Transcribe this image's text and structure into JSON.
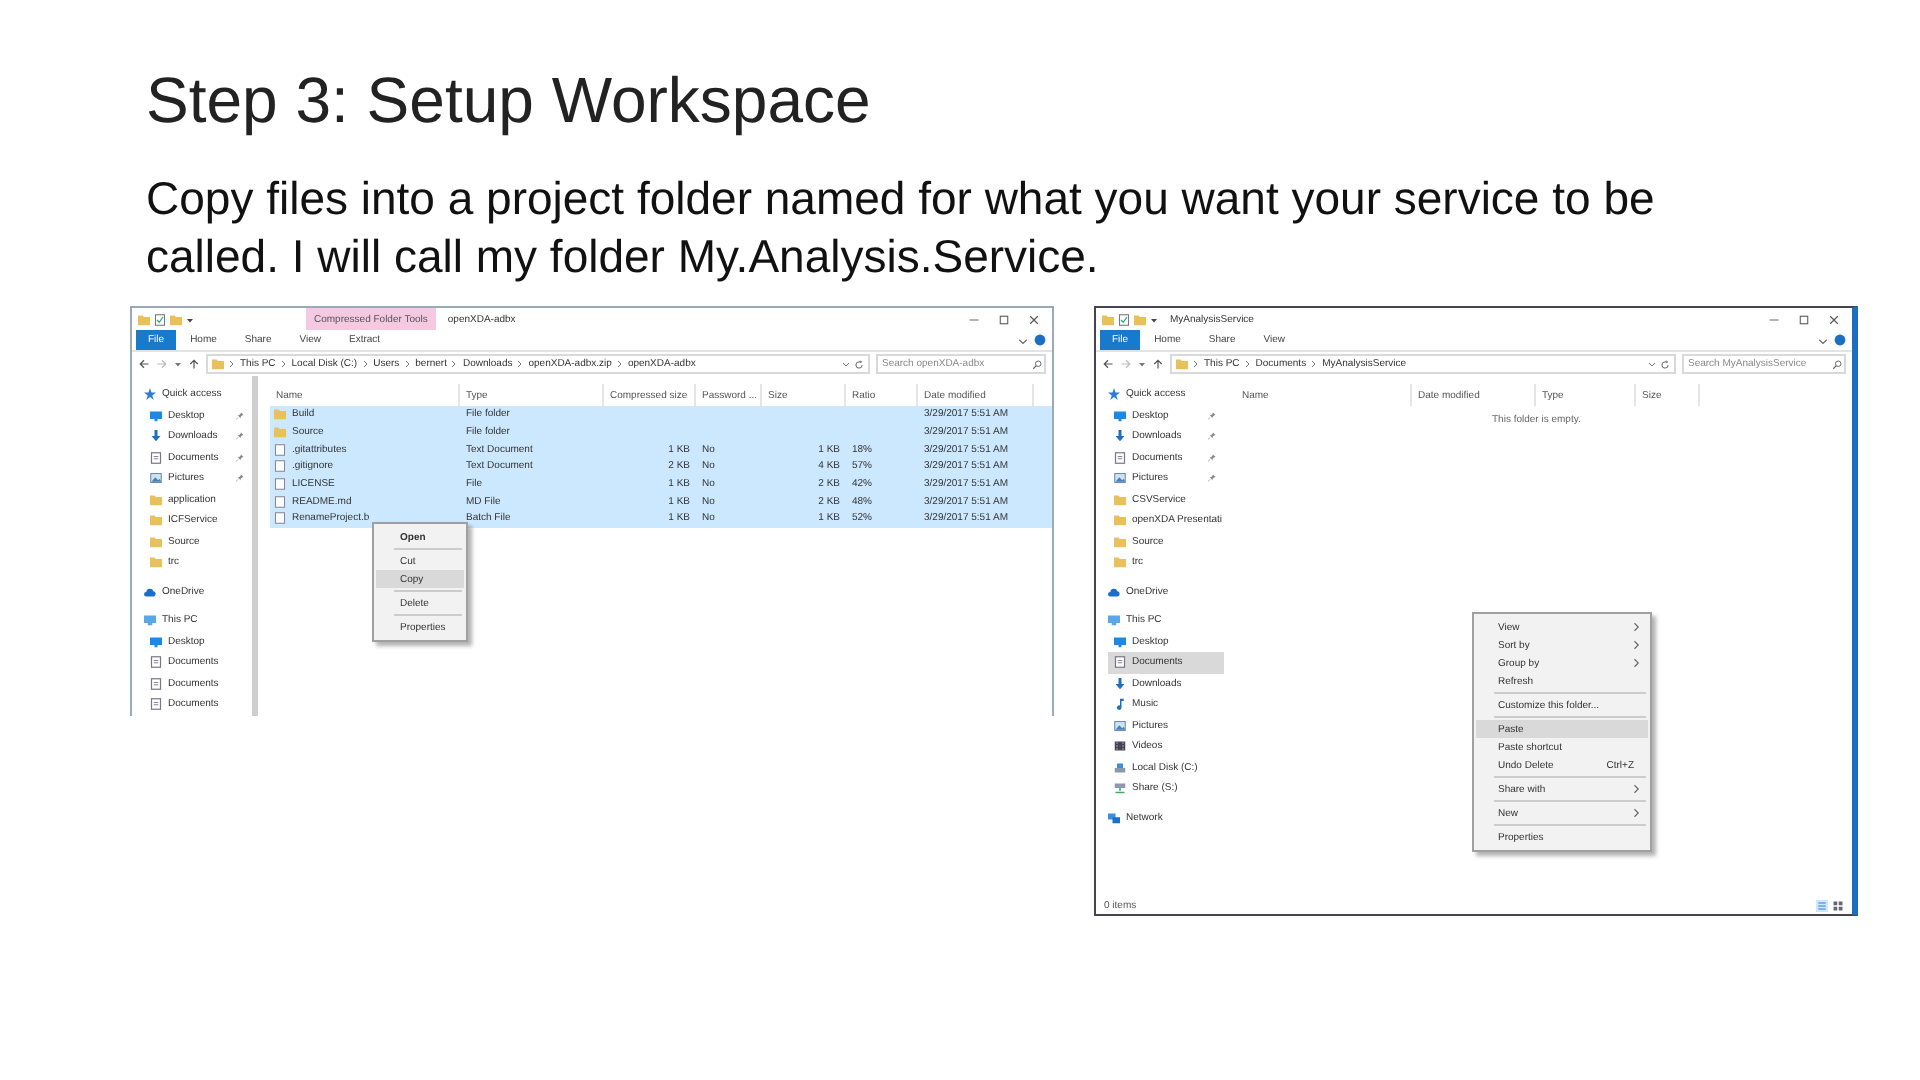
{
  "slide": {
    "title": "Step 3: Setup Workspace",
    "body": "Copy files into a project folder named for what you want your service to be called. I will call my folder My.Analysis.Service."
  },
  "left_window": {
    "contextual_tab": "Compressed Folder Tools",
    "title": "openXDA-adbx",
    "ribbon_tabs": [
      {
        "label": "File",
        "kind": "file"
      },
      {
        "label": "Home",
        "kind": "tab"
      },
      {
        "label": "Share",
        "kind": "tab"
      },
      {
        "label": "View",
        "kind": "tab"
      },
      {
        "label": "Extract",
        "kind": "tab"
      }
    ],
    "address": [
      "This PC",
      "Local Disk (C:)",
      "Users",
      "bernert",
      "Downloads",
      "openXDA-adbx.zip",
      "openXDA-adbx"
    ],
    "search": {
      "placeholder": "Search openXDA-adbx"
    },
    "nav": [
      {
        "label": "Quick access",
        "kind": "star",
        "selected": false,
        "children": [
          {
            "label": "Desktop",
            "kind": "desktop",
            "pinned": true,
            "selected": false
          },
          {
            "label": "Downloads",
            "kind": "download",
            "pinned": true,
            "selected": false
          },
          {
            "label": "Documents",
            "kind": "document",
            "pinned": true,
            "selected": false
          },
          {
            "label": "Pictures",
            "kind": "pictures",
            "pinned": true,
            "selected": false
          },
          {
            "label": "application",
            "kind": "folder",
            "pinned": false,
            "selected": false
          },
          {
            "label": "ICFService",
            "kind": "folder",
            "pinned": false,
            "selected": false
          },
          {
            "label": "Source",
            "kind": "folder",
            "pinned": false,
            "selected": false
          },
          {
            "label": "trc",
            "kind": "folder",
            "pinned": false,
            "selected": false
          }
        ]
      },
      {
        "label": "OneDrive",
        "kind": "cloud",
        "selected": false
      },
      {
        "label": "This PC",
        "kind": "pc",
        "selected": false,
        "children": [
          {
            "label": "Desktop",
            "kind": "desktop",
            "pinned": false,
            "selected": false
          },
          {
            "label": "Documents",
            "kind": "document",
            "pinned": false,
            "selected": false
          },
          {
            "label": "Documents",
            "kind": "document",
            "pinned": false,
            "selected": false
          },
          {
            "label": "Documents",
            "kind": "document",
            "pinned": false,
            "selected": false
          }
        ]
      }
    ],
    "columns": [
      "Name",
      "Type",
      "Compressed size",
      "Password ...",
      "Size",
      "Ratio",
      "Date modified"
    ],
    "rows": [
      {
        "kind": "folder",
        "selected": true,
        "name": "Build",
        "type": "File folder",
        "date_modified": "3/29/2017 5:51 AM"
      },
      {
        "kind": "folder",
        "selected": true,
        "name": "Source",
        "type": "File folder",
        "date_modified": "3/29/2017 5:51 AM"
      },
      {
        "kind": "file",
        "selected": true,
        "name": ".gitattributes",
        "type": "Text Document",
        "compressed_size": "1 KB",
        "password": "No",
        "size": "1 KB",
        "ratio": "18%",
        "date_modified": "3/29/2017 5:51 AM"
      },
      {
        "kind": "file",
        "selected": true,
        "name": ".gitignore",
        "type": "Text Document",
        "compressed_size": "2 KB",
        "password": "No",
        "size": "4 KB",
        "ratio": "57%",
        "date_modified": "3/29/2017 5:51 AM"
      },
      {
        "kind": "file",
        "selected": true,
        "name": "LICENSE",
        "type": "File",
        "compressed_size": "1 KB",
        "password": "No",
        "size": "2 KB",
        "ratio": "42%",
        "date_modified": "3/29/2017 5:51 AM"
      },
      {
        "kind": "file",
        "selected": true,
        "name": "README.md",
        "type": "MD File",
        "compressed_size": "1 KB",
        "password": "No",
        "size": "2 KB",
        "ratio": "48%",
        "date_modified": "3/29/2017 5:51 AM"
      },
      {
        "kind": "file",
        "selected": true,
        "name": "RenameProject.b",
        "type": "Batch File",
        "compressed_size": "1 KB",
        "password": "No",
        "size": "1 KB",
        "ratio": "52%",
        "date_modified": "3/29/2017 5:51 AM"
      }
    ],
    "context_menu": [
      {
        "kind": "item",
        "label": "Open",
        "default": true,
        "selected": false
      },
      {
        "kind": "separator"
      },
      {
        "kind": "item",
        "label": "Cut",
        "default": false,
        "selected": false
      },
      {
        "kind": "item",
        "label": "Copy",
        "default": false,
        "selected": true
      },
      {
        "kind": "separator"
      },
      {
        "kind": "item",
        "label": "Delete",
        "default": false,
        "selected": false
      },
      {
        "kind": "separator"
      },
      {
        "kind": "item",
        "label": "Properties",
        "default": false,
        "selected": false
      }
    ]
  },
  "right_window": {
    "title": "MyAnalysisService",
    "ribbon_tabs": [
      {
        "label": "File",
        "kind": "file"
      },
      {
        "label": "Home",
        "kind": "tab"
      },
      {
        "label": "Share",
        "kind": "tab"
      },
      {
        "label": "View",
        "kind": "tab"
      }
    ],
    "address": [
      "This PC",
      "Documents",
      "MyAnalysisService"
    ],
    "search": {
      "placeholder": "Search MyAnalysisService"
    },
    "nav": [
      {
        "label": "Quick access",
        "kind": "star",
        "selected": false,
        "children": [
          {
            "label": "Desktop",
            "kind": "desktop",
            "pinned": true,
            "selected": false
          },
          {
            "label": "Downloads",
            "kind": "download",
            "pinned": true,
            "selected": false
          },
          {
            "label": "Documents",
            "kind": "document",
            "pinned": true,
            "selected": false
          },
          {
            "label": "Pictures",
            "kind": "pictures",
            "pinned": true,
            "selected": false
          },
          {
            "label": "CSVService",
            "kind": "folder",
            "pinned": false,
            "selected": false
          },
          {
            "label": "openXDA Presentati",
            "kind": "folder",
            "pinned": false,
            "selected": false
          },
          {
            "label": "Source",
            "kind": "folder",
            "pinned": false,
            "selected": false
          },
          {
            "label": "trc",
            "kind": "folder",
            "pinned": false,
            "selected": false
          }
        ]
      },
      {
        "label": "OneDrive",
        "kind": "cloud",
        "selected": false
      },
      {
        "label": "This PC",
        "kind": "pc",
        "selected": false,
        "children": [
          {
            "label": "Desktop",
            "kind": "desktop",
            "pinned": false,
            "selected": false
          },
          {
            "label": "Documents",
            "kind": "document",
            "pinned": false,
            "selected": true
          },
          {
            "label": "Downloads",
            "kind": "download",
            "pinned": false,
            "selected": false
          },
          {
            "label": "Music",
            "kind": "music",
            "pinned": false,
            "selected": false
          },
          {
            "label": "Pictures",
            "kind": "pictures",
            "pinned": false,
            "selected": false
          },
          {
            "label": "Videos",
            "kind": "video",
            "pinned": false,
            "selected": false
          },
          {
            "label": "Local Disk (C:)",
            "kind": "disk",
            "pinned": false,
            "selected": false
          },
          {
            "label": "Share (S:)",
            "kind": "netdisk",
            "pinned": false,
            "selected": false
          }
        ]
      },
      {
        "label": "Network",
        "kind": "network",
        "selected": false
      }
    ],
    "columns": [
      "Name",
      "Date modified",
      "Type",
      "Size"
    ],
    "empty_message": "This folder is empty.",
    "context_menu": [
      {
        "kind": "item",
        "label": "View",
        "submenu": true,
        "selected": false
      },
      {
        "kind": "item",
        "label": "Sort by",
        "submenu": true,
        "selected": false
      },
      {
        "kind": "item",
        "label": "Group by",
        "submenu": true,
        "selected": false
      },
      {
        "kind": "item",
        "label": "Refresh",
        "submenu": false,
        "selected": false
      },
      {
        "kind": "separator"
      },
      {
        "kind": "item",
        "label": "Customize this folder...",
        "submenu": false,
        "selected": false
      },
      {
        "kind": "separator"
      },
      {
        "kind": "item",
        "label": "Paste",
        "submenu": false,
        "selected": true
      },
      {
        "kind": "item",
        "label": "Paste shortcut",
        "submenu": false,
        "selected": false
      },
      {
        "kind": "item",
        "label": "Undo Delete",
        "shortcut": "Ctrl+Z",
        "submenu": false,
        "selected": false
      },
      {
        "kind": "separator"
      },
      {
        "kind": "item",
        "label": "Share with",
        "submenu": true,
        "selected": false
      },
      {
        "kind": "separator"
      },
      {
        "kind": "item",
        "label": "New",
        "submenu": true,
        "selected": false
      },
      {
        "kind": "separator"
      },
      {
        "kind": "item",
        "label": "Properties",
        "submenu": false,
        "selected": false
      }
    ],
    "status": "0 items"
  }
}
